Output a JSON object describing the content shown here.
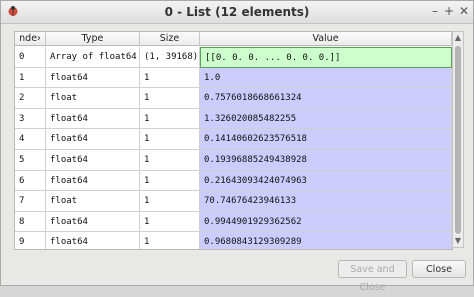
{
  "window": {
    "title": "0 - List (12 elements)",
    "controls": {
      "minimize": "–",
      "maximize": "+",
      "close": "✕"
    }
  },
  "table": {
    "headers": [
      "nde›",
      "Type",
      "Size",
      "Value"
    ],
    "rows": [
      {
        "index": "0",
        "type": "Array of float64",
        "size": "(1, 39168)",
        "value": "[[0. 0. 0. ... 0. 0. 0.]]"
      },
      {
        "index": "1",
        "type": "float64",
        "size": "1",
        "value": "1.0"
      },
      {
        "index": "2",
        "type": "float",
        "size": "1",
        "value": "0.7576018668661324"
      },
      {
        "index": "3",
        "type": "float64",
        "size": "1",
        "value": "1.326020085482255"
      },
      {
        "index": "4",
        "type": "float64",
        "size": "1",
        "value": "0.14140602623576518"
      },
      {
        "index": "5",
        "type": "float64",
        "size": "1",
        "value": "0.19396885249438928"
      },
      {
        "index": "6",
        "type": "float64",
        "size": "1",
        "value": "0.21643093424074963"
      },
      {
        "index": "7",
        "type": "float",
        "size": "1",
        "value": "70.74676423946133"
      },
      {
        "index": "8",
        "type": "float64",
        "size": "1",
        "value": "0.9944901929362562"
      },
      {
        "index": "9",
        "type": "float64",
        "size": "1",
        "value": "0.9680843129309289"
      }
    ]
  },
  "buttons": {
    "save_close": "Save and Close",
    "close": "Close"
  },
  "colors": {
    "selected_row": "#ccffcc",
    "value_column": "#ccccfe"
  }
}
